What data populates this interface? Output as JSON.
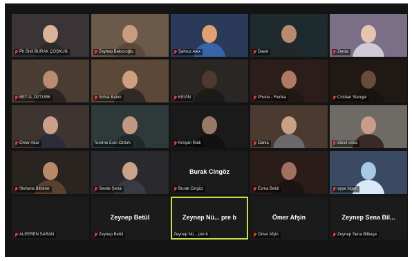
{
  "participants": [
    {
      "name": "Ph.Sivil BURAK ÇOŞKUN",
      "video": true,
      "muted": true,
      "bg": "#3a3436",
      "skin": "#d9b39a",
      "shirt": "#2b2b2b"
    },
    {
      "name": "Zeynep Bakıcıoğlu",
      "video": true,
      "muted": true,
      "bg": "#6b5a4a",
      "skin": "#c99b7f",
      "shirt": "#5a4a3e"
    },
    {
      "name": "Şahruz Alex",
      "video": true,
      "muted": true,
      "bg": "#2b3a58",
      "skin": "#e0a070",
      "shirt": "#3a64a8"
    },
    {
      "name": "David",
      "video": true,
      "muted": true,
      "bg": "#1d2a2e",
      "skin": "#b98a6e",
      "shirt": "#20282a"
    },
    {
      "name": "Zerda",
      "video": true,
      "muted": true,
      "bg": "#7a6f86",
      "skin": "#e8c3b0",
      "shirt": "#cfc9d8"
    },
    {
      "name": "BETÜL ÖZTÜRK",
      "video": true,
      "muted": true,
      "bg": "#4a3e34",
      "skin": "#b98b70",
      "shirt": "#2b2421"
    },
    {
      "name": "Sirhat Balım",
      "video": true,
      "muted": true,
      "bg": "#5b4838",
      "skin": "#cfa080",
      "shirt": "#2f2a26"
    },
    {
      "name": "KEVİN",
      "video": true,
      "muted": true,
      "bg": "#2a2623",
      "skin": "#4a3a30",
      "shirt": "#1d1a18"
    },
    {
      "name": "Phone - Florika",
      "video": true,
      "muted": true,
      "bg": "#2a1d1a",
      "skin": "#b07a62",
      "shirt": "#241815"
    },
    {
      "name": "Cristian Stengel",
      "video": true,
      "muted": true,
      "bg": "#1f1814",
      "skin": "#6a4a3a",
      "shirt": "#1a1411"
    },
    {
      "name": "Ömer Akar",
      "video": true,
      "muted": true,
      "bg": "#3e3530",
      "skin": "#caa08a",
      "shirt": "#2a2c3a"
    },
    {
      "name": "Teslime Esin Öztürk",
      "video": true,
      "muted": false,
      "bg": "#2e3a3a",
      "skin": "#c29882",
      "shirt": "#1f2a2c"
    },
    {
      "name": "Kreşan Ralk",
      "video": true,
      "muted": true,
      "bg": "#1a1a1a",
      "skin": "#9a7868",
      "shirt": "#111111"
    },
    {
      "name": "Dania",
      "video": true,
      "muted": true,
      "bg": "#4a3a30",
      "skin": "#caa085",
      "shirt": "#6a6a6a"
    },
    {
      "name": "ebcel eska",
      "video": true,
      "muted": true,
      "bg": "#6e6a66",
      "skin": "#c89c86",
      "shirt": "#3a2a26"
    },
    {
      "name": "Stefania Bilbiner",
      "video": true,
      "muted": true,
      "bg": "#2a2420",
      "skin": "#b88a6a",
      "shirt": "#5a4030"
    },
    {
      "name": "Sevde Şena",
      "video": true,
      "muted": true,
      "bg": "#2a2a2e",
      "skin": "#caa28c",
      "shirt": "#3a3a42"
    },
    {
      "name": "Burak Cingöz",
      "video": false,
      "muted": true,
      "display": "Burak Cingöz"
    },
    {
      "name": "Esma Betül",
      "video": true,
      "muted": true,
      "bg": "#2a1c18",
      "skin": "#a07060",
      "shirt": "#1c1412"
    },
    {
      "name": "ayşe ölgen",
      "video": true,
      "muted": true,
      "bg": "#3a4a62",
      "skin": "#a8c8e8",
      "shirt": "#d8e8f8"
    },
    {
      "name": "ALPEREN SARAN",
      "video": false,
      "muted": true,
      "display": ""
    },
    {
      "name": "Zeynep Betül",
      "video": false,
      "muted": true,
      "display": "Zeynep Betül"
    },
    {
      "name": "Zeynep Nü... pre b",
      "video": false,
      "muted": false,
      "display": "Zeynep Nü... pre b",
      "active": true
    },
    {
      "name": "Ömer Afşin",
      "video": false,
      "muted": true,
      "display": "Ömer Afşin"
    },
    {
      "name": "Zeynep Sena Bilbaşe",
      "video": false,
      "muted": true,
      "display": "Zeynep Sena Bil..."
    }
  ]
}
